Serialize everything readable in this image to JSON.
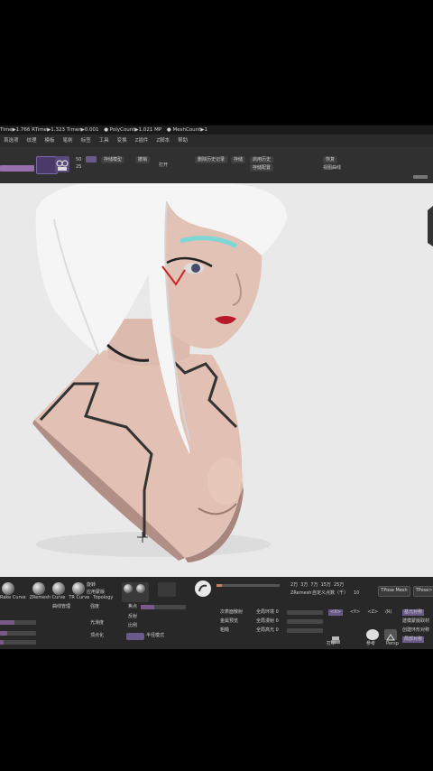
{
  "status_bar": {
    "items": [
      "Time▶1.766 RTime▶1.323 Timer▶0.001",
      "● PolyCount▶1.021 MP",
      "● MeshCount▶1"
    ]
  },
  "menu": {
    "items": [
      "首选项",
      "纹理",
      "模板",
      "笔刷",
      "标签",
      "工具",
      "变换",
      "Z插件",
      "Z脚本",
      "帮助"
    ]
  },
  "toolbar": {
    "fields": [
      {
        "label": "50"
      },
      {
        "label": "25"
      },
      {
        "label": "存储模型"
      },
      {
        "label": "撤销"
      },
      {
        "label": "打开"
      },
      {
        "label": "删除历史记录"
      },
      {
        "label": "存储"
      },
      {
        "label": "启用历史"
      },
      {
        "label": "存储配置"
      },
      {
        "label": "恢复"
      },
      {
        "label": "视图曲线"
      }
    ]
  },
  "bottom_panel": {
    "brushes": [
      "Rake Curve",
      "ZRemesh Curve",
      "TR Curve",
      "Topology"
    ],
    "misc_labels": [
      "旋转",
      "应用蒙版",
      "曲线管理",
      "强度",
      "焦点",
      "光滑度",
      "反射",
      "比例",
      "顶点化",
      "半径模式"
    ],
    "props": [
      "次表面散射",
      "全局环境 0",
      "金属预览",
      "全局漫射 0",
      "粗糙",
      "全局高光 0"
    ],
    "counts": [
      "2万",
      "3万",
      "7万",
      "15万",
      "25万"
    ],
    "target_label": "自定义点数（千）",
    "target_value": "10",
    "zremesh_button": "ZRemesh",
    "tpose_button": "TPose Mesh",
    "tpose2_button": "TPose>",
    "axis_buttons": [
      "<X>",
      "<Y>",
      "<Z>",
      "(R)"
    ],
    "right_buttons": [
      "基元对称",
      "建模蒙版取材",
      "创建环形对称",
      "局部对称"
    ],
    "bottom_icons": [
      "打印",
      "参考",
      "局部",
      "Actual",
      "Persp"
    ]
  }
}
